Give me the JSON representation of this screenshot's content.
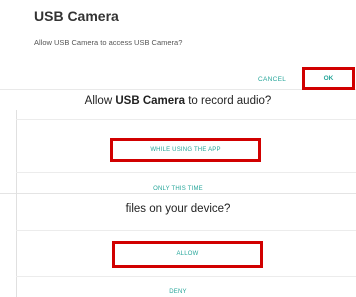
{
  "camera_dialog": {
    "title": "USB Camera",
    "message": "Allow USB Camera to access USB Camera?",
    "cancel_label": "CANCEL",
    "ok_label": "OK"
  },
  "audio_dialog": {
    "prefix": "Allow ",
    "app_name": "USB Camera",
    "suffix": " to record audio?",
    "while_using_label": "WHILE USING THE APP",
    "only_this_time_label": "ONLY THIS TIME"
  },
  "files_dialog": {
    "question": "files on your device?",
    "allow_label": "ALLOW",
    "deny_label": "DENY"
  },
  "colors": {
    "accent": "#26a69a",
    "highlight": "#d10000"
  }
}
